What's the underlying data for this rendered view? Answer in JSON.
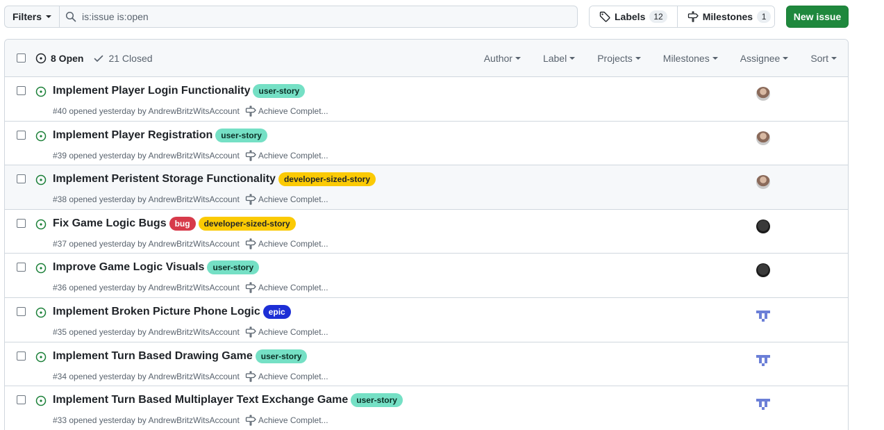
{
  "toolbar": {
    "filters_label": "Filters",
    "search_value": "is:issue is:open",
    "labels_label": "Labels",
    "labels_count": "12",
    "milestones_label": "Milestones",
    "milestones_count": "1",
    "new_issue_label": "New issue"
  },
  "header": {
    "open_label": "8 Open",
    "closed_label": "21 Closed",
    "filters": [
      "Author",
      "Label",
      "Projects",
      "Milestones",
      "Assignee",
      "Sort"
    ]
  },
  "colors": {
    "user_story": "#75e0c5",
    "developer_sized_story": "#fbca04",
    "bug": "#d73a4a",
    "epic": "#1d2fd6",
    "open_green": "#1a7f37",
    "new_issue_green": "#1f883d"
  },
  "issues": [
    {
      "title": "Implement Player Login Functionality",
      "labels": [
        {
          "name": "user-story",
          "bg": "#75e0c5",
          "fg": "#0b2f26"
        }
      ],
      "meta": "#40 opened yesterday by AndrewBritzWitsAccount",
      "milestone": "Achieve Complet...",
      "avatar": "photo"
    },
    {
      "title": "Implement Player Registration",
      "labels": [
        {
          "name": "user-story",
          "bg": "#75e0c5",
          "fg": "#0b2f26"
        }
      ],
      "meta": "#39 opened yesterday by AndrewBritzWitsAccount",
      "milestone": "Achieve Complet...",
      "avatar": "photo"
    },
    {
      "title": "Implement Peristent Storage Functionality",
      "labels": [
        {
          "name": "developer-sized-story",
          "bg": "#fbca04",
          "fg": "#1f2328"
        }
      ],
      "meta": "#38 opened yesterday by AndrewBritzWitsAccount",
      "milestone": "Achieve Complet...",
      "avatar": "photo"
    },
    {
      "title": "Fix Game Logic Bugs",
      "labels": [
        {
          "name": "bug",
          "bg": "#d73a4a",
          "fg": "#ffffff"
        },
        {
          "name": "developer-sized-story",
          "bg": "#fbca04",
          "fg": "#1f2328"
        }
      ],
      "meta": "#37 opened yesterday by AndrewBritzWitsAccount",
      "milestone": "Achieve Complet...",
      "avatar": "dark"
    },
    {
      "title": "Improve Game Logic Visuals",
      "labels": [
        {
          "name": "user-story",
          "bg": "#75e0c5",
          "fg": "#0b2f26"
        }
      ],
      "meta": "#36 opened yesterday by AndrewBritzWitsAccount",
      "milestone": "Achieve Complet...",
      "avatar": "dark"
    },
    {
      "title": "Implement Broken Picture Phone Logic",
      "labels": [
        {
          "name": "epic",
          "bg": "#1d2fd6",
          "fg": "#ffffff"
        }
      ],
      "meta": "#35 opened yesterday by AndrewBritzWitsAccount",
      "milestone": "Achieve Complet...",
      "avatar": "identicon"
    },
    {
      "title": "Implement Turn Based Drawing Game",
      "labels": [
        {
          "name": "user-story",
          "bg": "#75e0c5",
          "fg": "#0b2f26"
        }
      ],
      "meta": "#34 opened yesterday by AndrewBritzWitsAccount",
      "milestone": "Achieve Complet...",
      "avatar": "identicon"
    },
    {
      "title": "Implement Turn Based Multiplayer Text Exchange Game",
      "labels": [
        {
          "name": "user-story",
          "bg": "#75e0c5",
          "fg": "#0b2f26"
        }
      ],
      "meta": "#33 opened yesterday by AndrewBritzWitsAccount",
      "milestone": "Achieve Complet...",
      "avatar": "identicon"
    }
  ]
}
